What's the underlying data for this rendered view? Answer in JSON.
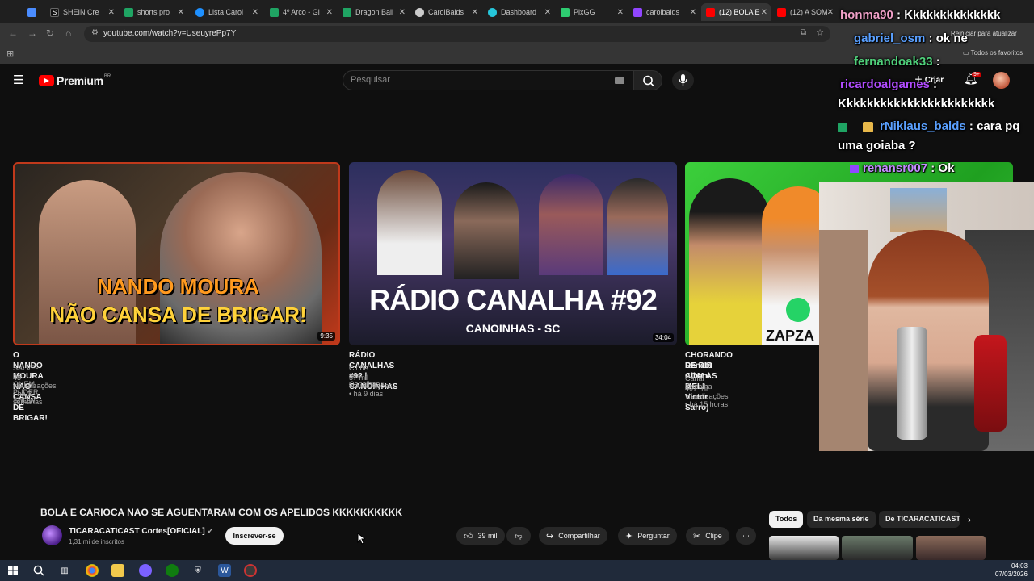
{
  "browser": {
    "tabs": [
      {
        "label": "",
        "color": "#4a8cff"
      },
      {
        "label": "SHEIN Cre",
        "color": "#111111"
      },
      {
        "label": "shorts pro",
        "color": "#1fa463"
      },
      {
        "label": "Lista Carol",
        "color": "#1e90ff"
      },
      {
        "label": "4º Arco - Gi",
        "color": "#1fa463"
      },
      {
        "label": "Dragon Ball",
        "color": "#1fa463"
      },
      {
        "label": "CarolBalds",
        "color": "#cccccc"
      },
      {
        "label": "Dashboard",
        "color": "#26c6da"
      },
      {
        "label": "PixGG",
        "color": "#2ecc71"
      },
      {
        "label": "carolbalds",
        "color": "#9146ff"
      },
      {
        "label": "(12) BOLA E",
        "color": "#ff0000",
        "active": true
      },
      {
        "label": "(12) A SOM",
        "color": "#ff0000"
      }
    ],
    "url": "youtube.com/watch?v=UseuyrePp7Y",
    "reload_hint": "Reiniciar para atualizar",
    "bookmarks_all": "Todos os favoritos"
  },
  "youtube": {
    "logo_text": "Premium",
    "logo_region": "BR",
    "search_placeholder": "Pesquisar",
    "create_label": "Criar",
    "notif_badge": "9+"
  },
  "videos": [
    {
      "title": "O NANDO MOURA NÃO CANSA DE BRIGAR!",
      "channel": "SALVE-SE QUEM PUDER SHOW",
      "meta": "43 visualizações • há 3 semanas",
      "duration": "9:35",
      "thumb_text_1": "NANDO MOURA",
      "thumb_text_2": "NÃO CANSA DE BRIGAR!"
    },
    {
      "title": "RÁDIO CANALHAS #92 | CANOINHAS",
      "channel": "Clube dos Canalhas",
      "meta": "57 mil visualizações • há 9 dias",
      "duration": "34:04",
      "thumb_text_1": "RÁDIO CANALHA #92",
      "thumb_text_2": "CANOINHAS - SC"
    },
    {
      "title_line1": "CHORANDO DE RIR COM AS MELI",
      "title_line2": "Renato Albani & Victor Sarro)",
      "channel": "Canal Canalha",
      "meta": "407 mil visualizações • há 15 horas",
      "thumb_text_1": "ZAPZA"
    }
  ],
  "watch": {
    "title": "BOLA E CARIOCA NAO SE AGUENTARAM COM OS APELIDOS KKKKKKKKKK",
    "channel_name": "TICARACATICAST Cortes[OFICIAL]",
    "subscribers": "1,31 mi de inscritos",
    "subscribe_label": "Inscrever-se",
    "likes": "39 mil",
    "share_label": "Compartilhar",
    "ask_label": "Perguntar",
    "clip_label": "Clipe"
  },
  "chips": [
    "Todos",
    "Da mesma série",
    "De TICARACATICAST"
  ],
  "chat": [
    {
      "user": "honma90",
      "msg": "Kkkkkkkkkkkkkk",
      "color": "#f0a0c8"
    },
    {
      "user": "gabriel_osm",
      "msg": "ok ne",
      "color": "#5aa0ff"
    },
    {
      "user": "fernandoak33",
      "msg": "",
      "color": "#4fd07a"
    },
    {
      "user": "ricardoalgames",
      "msg": "",
      "color": "#b14cff"
    },
    {
      "user": "",
      "msg": "Kkkkkkkkkkkkkkkkkkkkkkk",
      "color": "#ffffff"
    },
    {
      "user": "rNiklaus_balds",
      "msg": "cara pq",
      "color": "#5aa0ff"
    },
    {
      "user": "",
      "msg": "uma goiaba ?",
      "color": "#ffffff"
    },
    {
      "user": "renansr007",
      "msg": "Ok",
      "color": "#c48cff"
    }
  ],
  "taskbar": {
    "time": "04:03",
    "date": "07/03/2026"
  }
}
